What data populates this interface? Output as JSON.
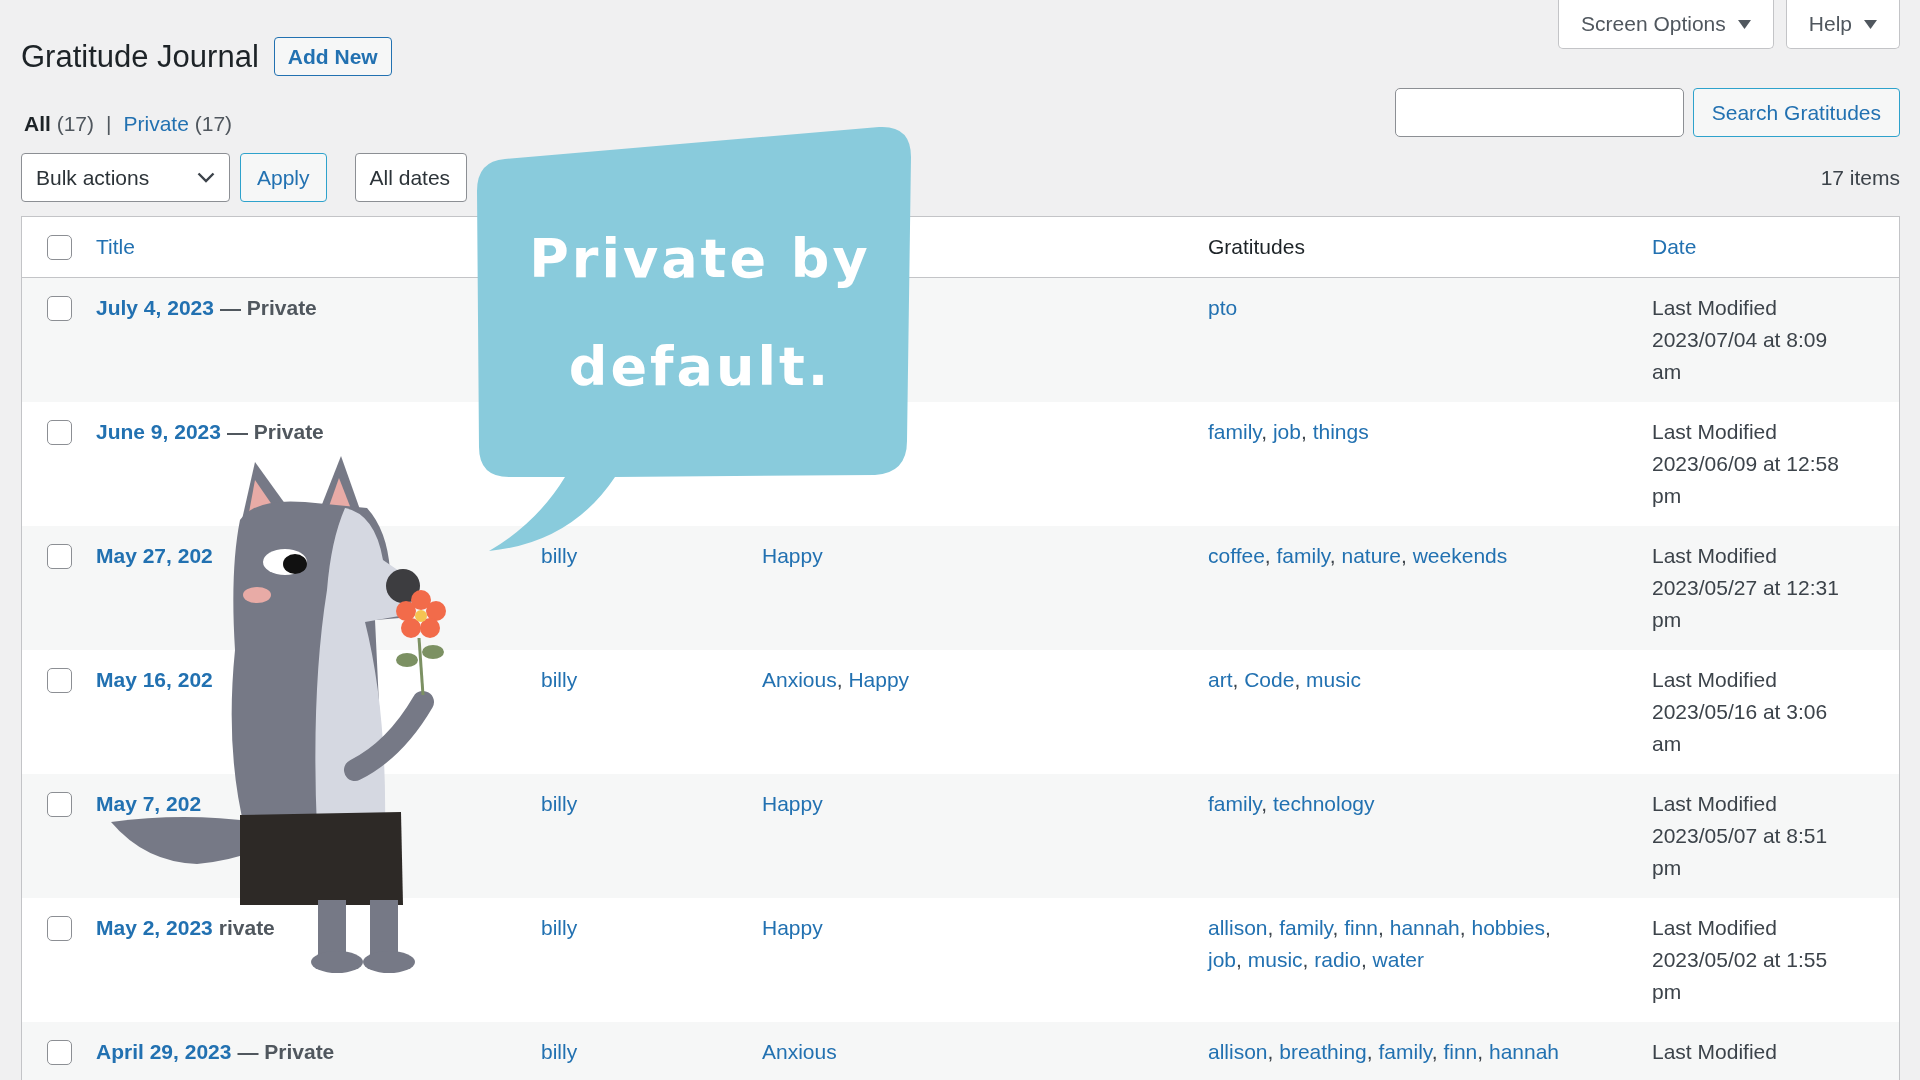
{
  "page_title": "Gratitude Journal",
  "add_new": "Add New",
  "screen_tabs": [
    {
      "label": "Screen Options"
    },
    {
      "label": "Help"
    }
  ],
  "views": [
    {
      "label": "All",
      "count": "(17)",
      "selected": true
    },
    {
      "label": "Private",
      "count": "(17)",
      "selected": false
    }
  ],
  "views_separator": "|",
  "search": {
    "button": "Search Gratitudes"
  },
  "bulk_actions": {
    "value": "Bulk actions",
    "apply": "Apply"
  },
  "date_filter": {
    "value": "All dates"
  },
  "items_count": "17 items",
  "list_separator": ", ",
  "table": {
    "select_all_checked": false,
    "columns": [
      {
        "label": "Title",
        "sortable": true
      },
      {
        "label": "Gratitudes",
        "sortable": false
      },
      {
        "label": "Date",
        "sortable": true
      }
    ],
    "rows": [
      {
        "title": "July 4, 2023",
        "status": "— Private",
        "gratitudes": [
          "pto"
        ],
        "date_label": "Last Modified",
        "date_value": "2023/07/04 at 8:09 am",
        "checked": false
      },
      {
        "title": "June 9, 2023",
        "status": "— Private",
        "gratitudes": [
          "family",
          "job",
          "things"
        ],
        "date_label": "Last Modified",
        "date_value": "2023/06/09 at 12:58 pm",
        "checked": false
      },
      {
        "title": "May 27, 202",
        "author": "billy",
        "moods": [
          "Happy"
        ],
        "gratitudes": [
          "coffee",
          "family",
          "nature",
          "weekends"
        ],
        "date_label": "Last Modified",
        "date_value": "2023/05/27 at 12:31 pm",
        "checked": false
      },
      {
        "title": "May 16, 202",
        "author": "billy",
        "moods": [
          "Anxious",
          "Happy"
        ],
        "gratitudes": [
          "art",
          "Code",
          "music"
        ],
        "date_label": "Last Modified",
        "date_value": "2023/05/16 at 3:06 am",
        "checked": false
      },
      {
        "title": "May 7, 202",
        "author": "billy",
        "moods": [
          "Happy"
        ],
        "gratitudes": [
          "family",
          "technology"
        ],
        "date_label": "Last Modified",
        "date_value": "2023/05/07 at 8:51 pm",
        "checked": false
      },
      {
        "title": "May 2, 2023",
        "status": "rivate",
        "author": "billy",
        "moods": [
          "Happy"
        ],
        "gratitudes": [
          "allison",
          "family",
          "finn",
          "hannah",
          "hobbies",
          "job",
          "music",
          "radio",
          "water"
        ],
        "date_label": "Last Modified",
        "date_value": "2023/05/02 at 1:55 pm",
        "checked": false
      },
      {
        "title": "April 29, 2023",
        "status": "— Private",
        "author": "billy",
        "moods": [
          "Anxious"
        ],
        "gratitudes": [
          "allison",
          "breathing",
          "family",
          "finn",
          "hannah"
        ],
        "date_label": "Last Modified",
        "checked": false
      }
    ]
  },
  "speech_bubble": {
    "lines": [
      "Private by",
      "default."
    ]
  }
}
